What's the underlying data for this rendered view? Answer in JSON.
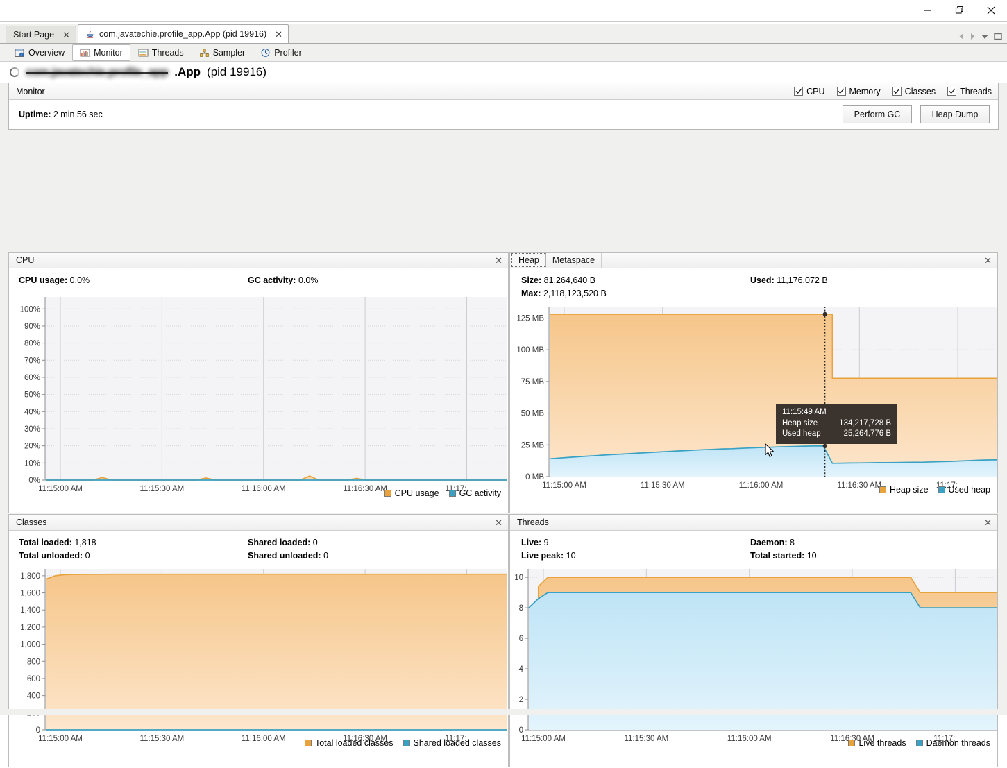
{
  "window": {
    "controls": [
      {
        "name": "minimize",
        "glyph": "—"
      },
      {
        "name": "maximize",
        "glyph": "❐"
      },
      {
        "name": "close",
        "glyph": "✕"
      }
    ]
  },
  "document_tabs": [
    {
      "label": "Start Page",
      "icon": "none",
      "active": false,
      "closable": true
    },
    {
      "label": "com.javatechie.profile_app.App (pid 19916)",
      "icon": "java-icon",
      "active": true,
      "closable": true
    }
  ],
  "tabstrip_controls": [
    {
      "name": "scroll-left-icon",
      "glyph": "◀"
    },
    {
      "name": "scroll-right-icon",
      "glyph": "▶"
    },
    {
      "name": "tab-list-chevron-icon",
      "glyph": "▼"
    },
    {
      "name": "maximize-tab-icon",
      "glyph": "❑"
    }
  ],
  "sub_tabs": [
    {
      "label": "Overview",
      "icon": "overview-icon",
      "active": false
    },
    {
      "label": "Monitor",
      "icon": "monitor-icon",
      "active": true
    },
    {
      "label": "Threads",
      "icon": "threads-icon",
      "active": false
    },
    {
      "label": "Sampler",
      "icon": "sampler-icon",
      "active": false
    },
    {
      "label": "Profiler",
      "icon": "profiler-icon",
      "active": false
    }
  ],
  "page_title": {
    "redacted_text": "com.javatechie.profile_app",
    "visible_suffix": ".App",
    "pid_text": "(pid 19916)"
  },
  "monitor": {
    "header_label": "Monitor",
    "checkboxes": [
      {
        "label": "CPU",
        "checked": true
      },
      {
        "label": "Memory",
        "checked": true
      },
      {
        "label": "Classes",
        "checked": true
      },
      {
        "label": "Threads",
        "checked": true
      }
    ],
    "uptime_label": "Uptime:",
    "uptime_value": "2 min 56 sec",
    "buttons": [
      {
        "label": "Perform GC"
      },
      {
        "label": "Heap Dump"
      }
    ]
  },
  "panels": {
    "cpu": {
      "title": "CPU",
      "close_glyph": "✕",
      "stats": [
        {
          "label": "CPU usage:",
          "value": "0.0%"
        },
        {
          "label": "GC activity:",
          "value": "0.0%"
        }
      ]
    },
    "memory": {
      "tabs": [
        {
          "label": "Heap",
          "selected": true
        },
        {
          "label": "Metaspace",
          "selected": false
        }
      ],
      "close_glyph": "✕",
      "stats": [
        {
          "label": "Size:",
          "value": "81,264,640 B"
        },
        {
          "label": "Used:",
          "value": "11,176,072 B"
        },
        {
          "label": "Max:",
          "value": "2,118,123,520 B"
        }
      ],
      "tooltip": {
        "time": "11:15:49 AM",
        "rows": [
          {
            "key": "Heap size",
            "value": "134,217,728 B"
          },
          {
            "key": "Used heap",
            "value": "25,264,776 B"
          }
        ]
      }
    },
    "classes": {
      "title": "Classes",
      "close_glyph": "✕",
      "stats": [
        {
          "label": "Total loaded:",
          "value": "1,818"
        },
        {
          "label": "Shared loaded:",
          "value": "0"
        },
        {
          "label": "Total unloaded:",
          "value": "0"
        },
        {
          "label": "Shared unloaded:",
          "value": "0"
        }
      ]
    },
    "threads": {
      "title": "Threads",
      "close_glyph": "✕",
      "stats": [
        {
          "label": "Live:",
          "value": "9"
        },
        {
          "label": "Daemon:",
          "value": "8"
        },
        {
          "label": "Live peak:",
          "value": "10"
        },
        {
          "label": "Total started:",
          "value": "10"
        }
      ]
    }
  },
  "colors": {
    "orange_line": "#e8a33d",
    "orange_fill_top": "#f6c68a",
    "orange_fill_bottom": "#fde6cc",
    "blue_line": "#38a1c4",
    "blue_fill": "#cfeaf8",
    "plot_bg": "#f4f3f6",
    "grid": "#d8d3dd",
    "axis_text": "#3c3c3c",
    "tooltip_bg": "#3b342e"
  },
  "chart_data": [
    {
      "type": "area",
      "id": "cpu-chart",
      "title": "CPU",
      "xlabel": "",
      "ylabel": "",
      "ylim": [
        0,
        100
      ],
      "yticks": [
        "0%",
        "10%",
        "20%",
        "30%",
        "40%",
        "50%",
        "60%",
        "70%",
        "80%",
        "90%",
        "100%"
      ],
      "xticks": [
        "11:15:00 AM",
        "11:15:30 AM",
        "11:16:00 AM",
        "11:16:30 AM",
        "11:17:"
      ],
      "grid": true,
      "legend_position": "bottom-right",
      "series": [
        {
          "name": "CPU usage",
          "color": "#e8a33d",
          "values": [
            0,
            0,
            0,
            0,
            0,
            0,
            1.5,
            0,
            0,
            0,
            0,
            0,
            0,
            0,
            0,
            0,
            0,
            1.2,
            0,
            0,
            0,
            0,
            0,
            0,
            0,
            0,
            0,
            0,
            2.4,
            0,
            0,
            0,
            0,
            1.0,
            0,
            0,
            0,
            0,
            0,
            0,
            0,
            0,
            0,
            0,
            0,
            0,
            0,
            0,
            0,
            0
          ]
        },
        {
          "name": "GC activity",
          "color": "#38a1c4",
          "values": [
            0,
            0,
            0,
            0,
            0,
            0,
            0,
            0,
            0,
            0,
            0,
            0,
            0,
            0,
            0,
            0,
            0,
            0,
            0,
            0,
            0,
            0,
            0,
            0,
            0,
            0,
            0,
            0,
            0,
            0,
            0,
            0,
            0,
            0,
            0,
            0,
            0,
            0,
            0,
            0,
            0,
            0,
            0,
            0,
            0,
            0,
            0,
            0,
            0,
            0
          ]
        }
      ]
    },
    {
      "type": "area",
      "id": "heap-chart",
      "title": "Heap",
      "xlabel": "",
      "ylabel": "",
      "ylim": [
        0,
        134217728
      ],
      "yticks": [
        "0 MB",
        "25 MB",
        "50 MB",
        "75 MB",
        "100 MB",
        "125 MB"
      ],
      "ytick_values_mb": [
        0,
        25,
        50,
        75,
        100,
        125
      ],
      "xticks": [
        "11:15:00 AM",
        "11:15:30 AM",
        "11:16:00 AM",
        "11:16:30 AM",
        "11:17:"
      ],
      "grid": true,
      "legend_position": "bottom-right",
      "series": [
        {
          "name": "Heap size",
          "color": "#e8a33d",
          "unit": "MB",
          "values": [
            128,
            128,
            128,
            128,
            128,
            128,
            128,
            128,
            128,
            128,
            128,
            128,
            128,
            128,
            128,
            128,
            128,
            128,
            128,
            128,
            128,
            128,
            128,
            128,
            128,
            128,
            128,
            128,
            128,
            128,
            128,
            77.5,
            77.5,
            77.5,
            77.5,
            77.5,
            77.5,
            77.5,
            77.5,
            77.5,
            77.5,
            77.5,
            77.5,
            77.5,
            77.5,
            77.5,
            77.5,
            77.5,
            77.5,
            77.5
          ]
        },
        {
          "name": "Used heap",
          "color": "#38a1c4",
          "unit": "MB",
          "values": [
            14.0,
            14.6,
            15.1,
            15.6,
            16.1,
            16.5,
            17.0,
            17.4,
            17.8,
            18.2,
            18.6,
            19.0,
            19.4,
            19.8,
            20.2,
            20.5,
            20.9,
            21.2,
            21.5,
            21.8,
            22.0,
            22.3,
            22.6,
            22.9,
            23.1,
            23.4,
            23.6,
            23.8,
            24.0,
            24.2,
            24.1,
            10.5,
            10.6,
            10.7,
            10.8,
            10.9,
            11.0,
            11.0,
            11.1,
            11.2,
            11.3,
            11.4,
            11.6,
            11.8,
            12.0,
            12.3,
            12.6,
            12.9,
            13.1,
            13.2
          ]
        }
      ],
      "annotations": [
        {
          "type": "tooltip",
          "time": "11:15:49 AM",
          "heap_size": "134,217,728 B",
          "used_heap": "25,264,776 B"
        }
      ]
    },
    {
      "type": "area",
      "id": "classes-chart",
      "title": "Classes",
      "xlabel": "",
      "ylabel": "",
      "ylim": [
        0,
        1900
      ],
      "yticks": [
        "0",
        "200",
        "400",
        "600",
        "800",
        "1,000",
        "1,200",
        "1,400",
        "1,600",
        "1,800"
      ],
      "xticks": [
        "11:15:00 AM",
        "11:15:30 AM",
        "11:16:00 AM",
        "11:16:30 AM",
        "11:17:"
      ],
      "grid": true,
      "legend_position": "bottom-right",
      "series": [
        {
          "name": "Total loaded classes",
          "color": "#e8a33d",
          "values": [
            1760,
            1800,
            1812,
            1815,
            1816,
            1817,
            1817,
            1818,
            1818,
            1818,
            1818,
            1818,
            1818,
            1818,
            1818,
            1818,
            1818,
            1818,
            1818,
            1818,
            1818,
            1818,
            1818,
            1818,
            1818,
            1818,
            1818,
            1818,
            1818,
            1818,
            1818,
            1818,
            1818,
            1818,
            1818,
            1818,
            1818,
            1818,
            1818,
            1818,
            1818,
            1818,
            1818,
            1818,
            1818,
            1818,
            1818,
            1818,
            1818,
            1818
          ]
        },
        {
          "name": "Shared loaded classes",
          "color": "#38a1c4",
          "values": [
            0,
            0,
            0,
            0,
            0,
            0,
            0,
            0,
            0,
            0,
            0,
            0,
            0,
            0,
            0,
            0,
            0,
            0,
            0,
            0,
            0,
            0,
            0,
            0,
            0,
            0,
            0,
            0,
            0,
            0,
            0,
            0,
            0,
            0,
            0,
            0,
            0,
            0,
            0,
            0,
            0,
            0,
            0,
            0,
            0,
            0,
            0,
            0,
            0,
            0
          ]
        }
      ]
    },
    {
      "type": "area",
      "id": "threads-chart",
      "title": "Threads",
      "xlabel": "",
      "ylabel": "",
      "ylim": [
        0,
        10.6
      ],
      "yticks": [
        "0",
        "2",
        "4",
        "6",
        "8",
        "10"
      ],
      "xticks": [
        "11:15:00 AM",
        "11:15:30 AM",
        "11:16:00 AM",
        "11:16:30 AM",
        "11:17:"
      ],
      "grid": true,
      "legend_position": "bottom-right",
      "series": [
        {
          "name": "Live threads",
          "color": "#e8a33d",
          "values": [
            8,
            9.4,
            10,
            10,
            10,
            10,
            10,
            10,
            10,
            10,
            10,
            10,
            10,
            10,
            10,
            10,
            10,
            10,
            10,
            10,
            10,
            10,
            10,
            10,
            10,
            10,
            10,
            10,
            10,
            10,
            10,
            10,
            10,
            10,
            10,
            10,
            10,
            10,
            10,
            10,
            10,
            9,
            9,
            9,
            9,
            9,
            9,
            9,
            9,
            9
          ]
        },
        {
          "name": "Daemon threads",
          "color": "#38a1c4",
          "values": [
            8,
            8.6,
            9,
            9,
            9,
            9,
            9,
            9,
            9,
            9,
            9,
            9,
            9,
            9,
            9,
            9,
            9,
            9,
            9,
            9,
            9,
            9,
            9,
            9,
            9,
            9,
            9,
            9,
            9,
            9,
            9,
            9,
            9,
            9,
            9,
            9,
            9,
            9,
            9,
            9,
            9,
            8,
            8,
            8,
            8,
            8,
            8,
            8,
            8,
            8
          ]
        }
      ]
    }
  ]
}
